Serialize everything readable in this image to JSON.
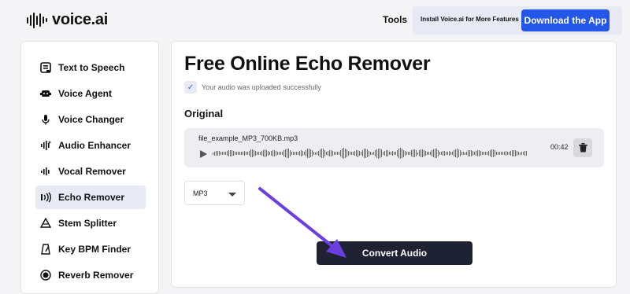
{
  "header": {
    "logo_text": "voice.ai",
    "tools_label": "Tools",
    "install_text": "Install Voice.ai for More Features",
    "download_label": "Download the App"
  },
  "sidebar": {
    "items": [
      {
        "label": "Text to Speech",
        "icon": "text-to-speech-icon",
        "active": false
      },
      {
        "label": "Voice Agent",
        "icon": "voice-agent-icon",
        "active": false
      },
      {
        "label": "Voice Changer",
        "icon": "microphone-icon",
        "active": false
      },
      {
        "label": "Audio Enhancer",
        "icon": "audio-enhancer-icon",
        "active": false
      },
      {
        "label": "Vocal Remover",
        "icon": "vocal-remover-icon",
        "active": false
      },
      {
        "label": "Echo Remover",
        "icon": "echo-icon",
        "active": true
      },
      {
        "label": "Stem Splitter",
        "icon": "stem-splitter-icon",
        "active": false
      },
      {
        "label": "Key BPM Finder",
        "icon": "metronome-icon",
        "active": false
      },
      {
        "label": "Reverb Remover",
        "icon": "reverb-icon",
        "active": false
      }
    ]
  },
  "main": {
    "title": "Free Online Echo Remover",
    "success_message": "Your audio was uploaded successfully",
    "section_label": "Original",
    "player": {
      "file_name": "file_example_MP3_700KB.mp3",
      "duration": "00:42"
    },
    "format": {
      "selected": "MP3"
    },
    "convert_label": "Convert Audio"
  },
  "colors": {
    "accent": "#2456e8",
    "convert_button": "#1e2233",
    "arrow": "#6a3ee0",
    "active_item_bg": "#e8ebf6"
  }
}
